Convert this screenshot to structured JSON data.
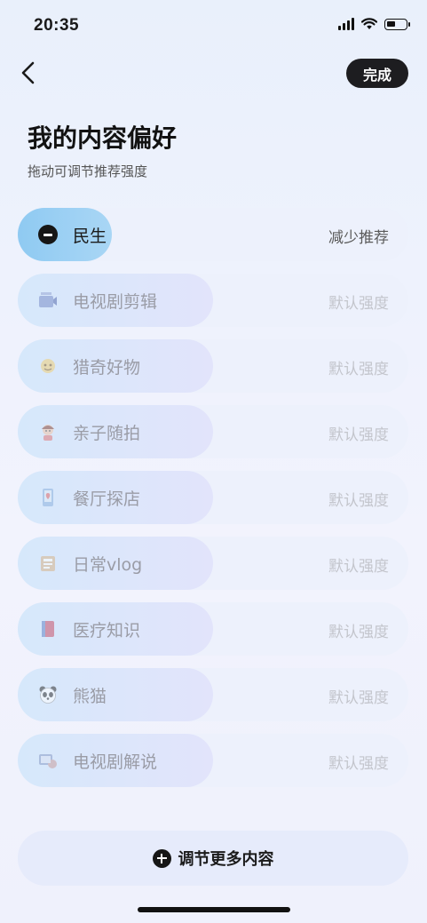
{
  "status_bar": {
    "time": "20:35"
  },
  "header": {
    "back_icon": "chevron-left-icon",
    "done_label": "完成"
  },
  "title": "我的内容偏好",
  "subtitle": "拖动可调节推荐强度",
  "preferences": [
    {
      "label": "民生",
      "strength": "减少推荐",
      "icon": "minus-circle-icon",
      "active": true
    },
    {
      "label": "电视剧剪辑",
      "strength": "默认强度",
      "icon": "tv-clip-icon",
      "color": "#7b8fc9"
    },
    {
      "label": "猎奇好物",
      "strength": "默认强度",
      "icon": "curio-icon",
      "color": "#e8c46a"
    },
    {
      "label": "亲子随拍",
      "strength": "默认强度",
      "icon": "family-icon",
      "color": "#d9867a"
    },
    {
      "label": "餐厅探店",
      "strength": "默认强度",
      "icon": "restaurant-icon",
      "color": "#7aa5d8"
    },
    {
      "label": "日常vlog",
      "strength": "默认强度",
      "icon": "vlog-icon",
      "color": "#c9a27a"
    },
    {
      "label": "医疗知识",
      "strength": "默认强度",
      "icon": "medical-icon",
      "color": "#c85a6a"
    },
    {
      "label": "熊猫",
      "strength": "默认强度",
      "icon": "panda-icon",
      "color": "#444444"
    },
    {
      "label": "电视剧解说",
      "strength": "默认强度",
      "icon": "tv-commentary-icon",
      "color": "#8a9cc8"
    }
  ],
  "more_button": {
    "label": "调节更多内容",
    "icon": "plus-circle-icon"
  }
}
